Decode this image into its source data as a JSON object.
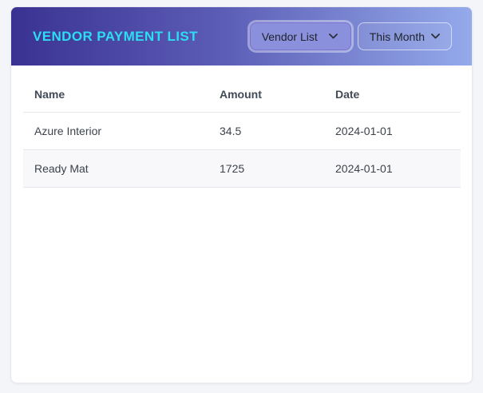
{
  "page": {
    "background_color": "#f3f5f8"
  },
  "card": {
    "header": {
      "title": "VENDOR PAYMENT LIST",
      "title_color": "#2bdef2",
      "gradient_left_color": "#3a3292",
      "gradient_right_color": "#94aaeb",
      "dropdowns": [
        {
          "label": "Vendor List",
          "icon": "chevron-down"
        },
        {
          "label": "This Month",
          "icon": "chevron-down"
        }
      ]
    },
    "table": {
      "columns": [
        "Name",
        "Amount",
        "Date"
      ],
      "rows": [
        [
          "Azure Interior",
          "34.5",
          "2024-01-01"
        ],
        [
          "Ready Mat",
          "1725",
          "2024-01-01"
        ]
      ],
      "stripe_color": "#f8f8fa"
    }
  }
}
